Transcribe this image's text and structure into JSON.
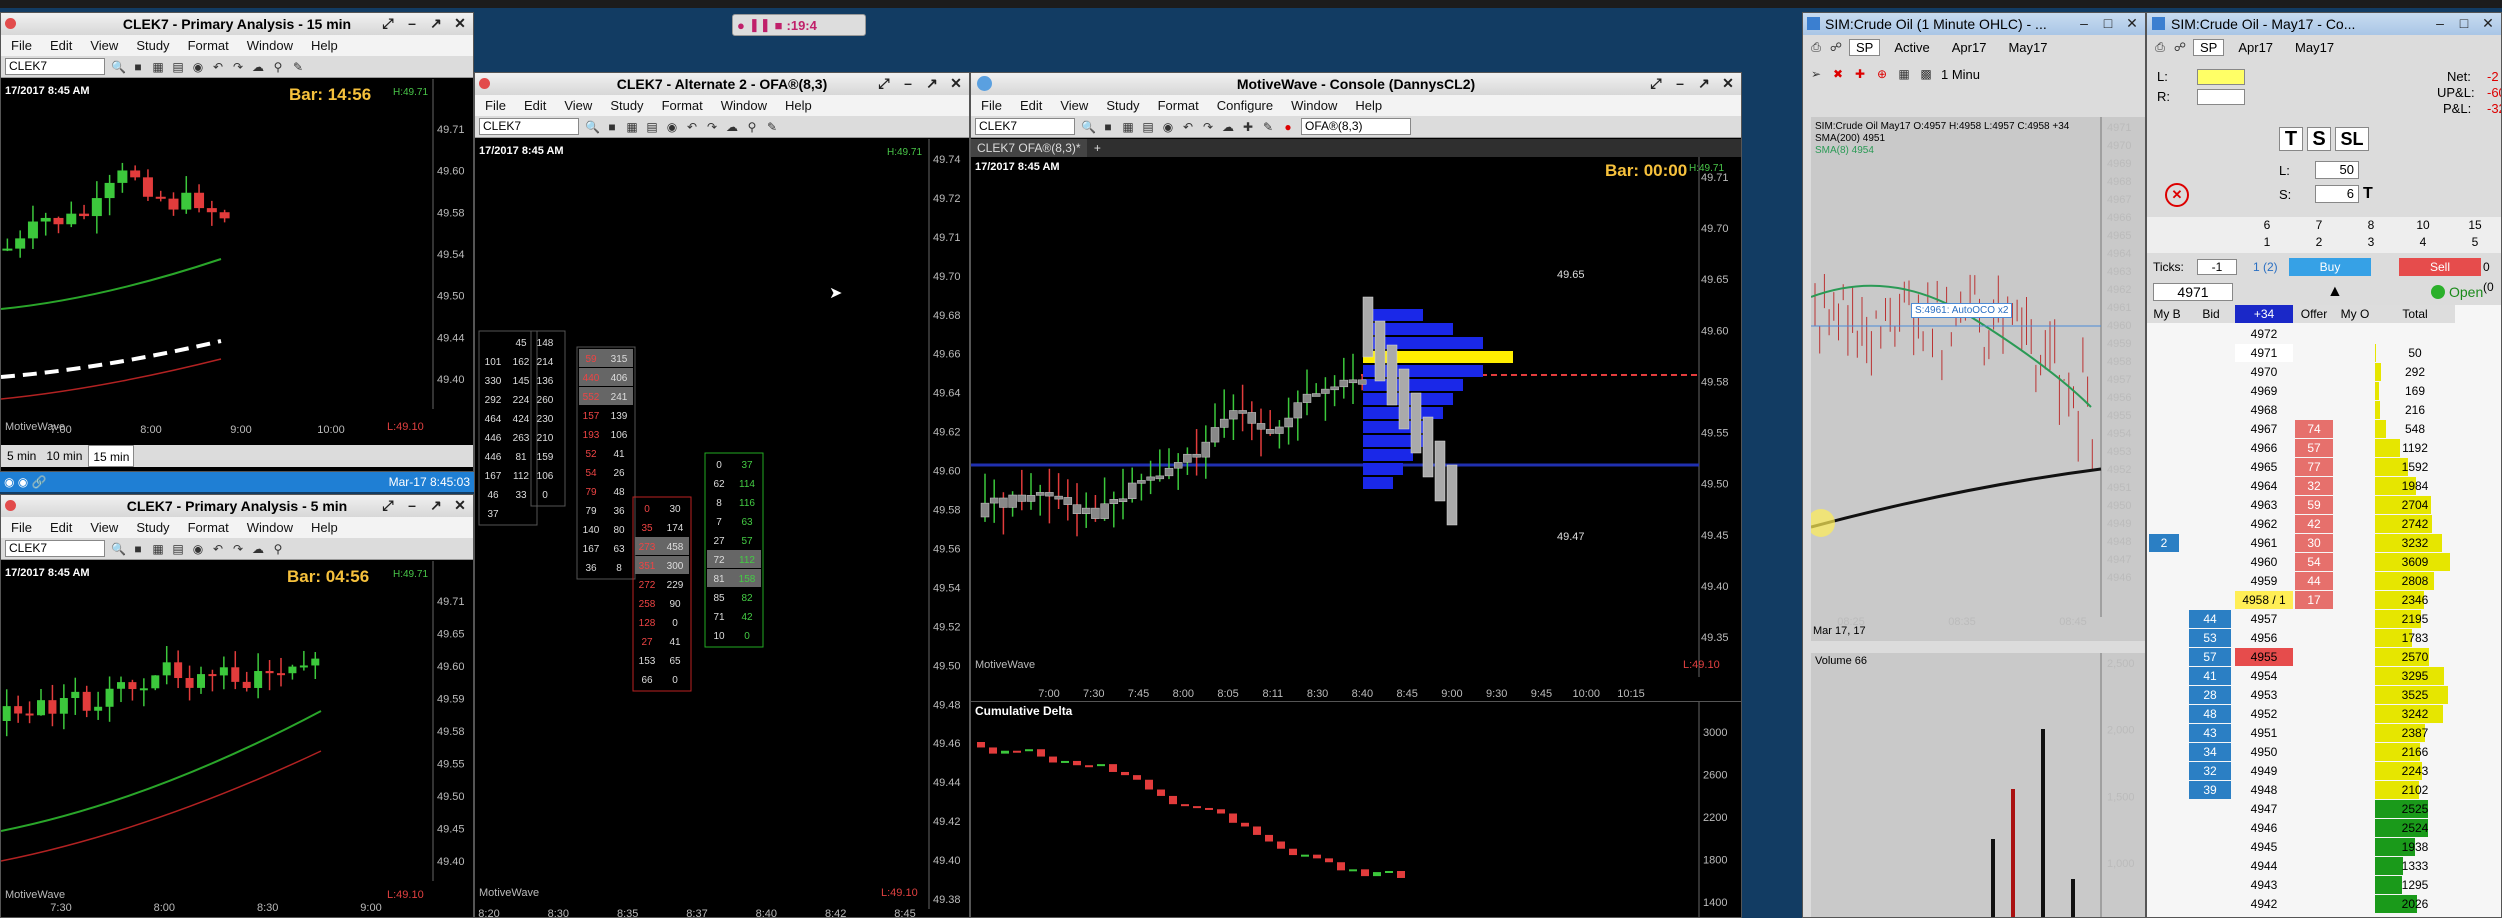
{
  "top_strip": {
    "counter": ":19:4"
  },
  "win15": {
    "title": "CLEK7 - Primary Analysis - 15 min",
    "menu": [
      "File",
      "Edit",
      "View",
      "Study",
      "Format",
      "Window",
      "Help"
    ],
    "symbol": "CLEK7",
    "date": "17/2017 8:45 AM",
    "bar": "Bar: 14:56",
    "high": "H:49.71",
    "low": "L:49.10",
    "watermark": "MotiveWave",
    "prices": [
      "49.71",
      "49.60",
      "49.58",
      "49.54",
      "49.50",
      "49.44",
      "49.40"
    ],
    "times": [
      "7:00",
      "8:00",
      "9:00",
      "10:00"
    ],
    "tabs": [
      "5 min",
      "10 min",
      "15 min"
    ],
    "status_date": "Mar-17 8:45:03"
  },
  "win5": {
    "title": "CLEK7 - Primary Analysis - 5 min",
    "menu": [
      "File",
      "Edit",
      "View",
      "Study",
      "Format",
      "Window",
      "Help"
    ],
    "symbol": "CLEK7",
    "date": "17/2017 8:45 AM",
    "bar": "Bar: 04:56",
    "high": "H:49.71",
    "low": "L:49.10",
    "watermark": "MotiveWave",
    "prices": [
      "49.71",
      "49.65",
      "49.60",
      "49.59",
      "49.58",
      "49.55",
      "49.50",
      "49.45",
      "49.40"
    ],
    "times": [
      "7:30",
      "8:00",
      "8:30",
      "9:00"
    ]
  },
  "win_ofa": {
    "title": "CLEK7 - Alternate 2 - OFA®(8,3)",
    "menu": [
      "File",
      "Edit",
      "View",
      "Study",
      "Format",
      "Window",
      "Help"
    ],
    "symbol": "CLEK7",
    "date": "17/2017 8:45 AM",
    "high": "H:49.71",
    "low": "L:49.10",
    "watermark": "MotiveWave",
    "prices": [
      "49.74",
      "49.72",
      "49.71",
      "49.70",
      "49.68",
      "49.66",
      "49.64",
      "49.62",
      "49.60",
      "49.58",
      "49.56",
      "49.54",
      "49.52",
      "49.50",
      "49.48",
      "49.46",
      "49.44",
      "49.42",
      "49.40",
      "49.38"
    ],
    "times": [
      "8:20",
      "8:30",
      "8:35",
      "8:37",
      "8:40",
      "8:42",
      "8:45"
    ],
    "footprints": [
      {
        "rows": [
          [
            "",
            "45"
          ],
          [
            "101",
            "162"
          ],
          [
            "330",
            "145"
          ],
          [
            "292",
            "224"
          ],
          [
            "464",
            "424"
          ],
          [
            "446",
            "263"
          ],
          [
            "446",
            "81"
          ],
          [
            "167",
            "112"
          ],
          [
            "46",
            "33"
          ],
          [
            "37",
            ""
          ]
        ]
      },
      {
        "rows": [
          [
            "148",
            ""
          ],
          [
            "214",
            ""
          ],
          [
            "136",
            ""
          ],
          [
            "260",
            ""
          ],
          [
            "230",
            ""
          ],
          [
            "210",
            ""
          ],
          [
            "159",
            ""
          ],
          [
            "106",
            ""
          ],
          [
            "0",
            ""
          ]
        ]
      },
      {
        "rows": [
          [
            "59",
            "315"
          ],
          [
            "440",
            "406"
          ],
          [
            "552",
            "241"
          ],
          [
            "157",
            "139"
          ],
          [
            "193",
            "106"
          ],
          [
            "52",
            "41"
          ],
          [
            "54",
            "26"
          ],
          [
            "79",
            "48"
          ],
          [
            "79",
            "36"
          ],
          [
            "140",
            "80"
          ],
          [
            "167",
            "63"
          ],
          [
            "36",
            "8"
          ]
        ]
      },
      {
        "rows": [
          [
            "0",
            "30"
          ],
          [
            "35",
            "174"
          ],
          [
            "273",
            "458"
          ],
          [
            "351",
            "300"
          ],
          [
            "272",
            "229"
          ],
          [
            "258",
            "90"
          ],
          [
            "128",
            "0"
          ],
          [
            "27",
            "41"
          ],
          [
            "153",
            "65"
          ],
          [
            "66",
            "0"
          ]
        ]
      },
      {
        "rows": [
          [
            "0",
            "37"
          ],
          [
            "62",
            "114"
          ],
          [
            "8",
            "116"
          ],
          [
            "7",
            "63"
          ],
          [
            "27",
            "57"
          ],
          [
            "72",
            "112"
          ],
          [
            "81",
            "158"
          ],
          [
            "85",
            "82"
          ],
          [
            "71",
            "42"
          ],
          [
            "10",
            "0"
          ]
        ]
      }
    ]
  },
  "console": {
    "title": "MotiveWave - Console (DannysCL2)",
    "menu": [
      "File",
      "Edit",
      "View",
      "Study",
      "Format",
      "Configure",
      "Window",
      "Help"
    ],
    "symbol": "CLEK7",
    "study": "OFA®(8,3)",
    "tab": "CLEK7 OFA®(8,3)*",
    "date": "17/2017 8:45 AM",
    "bar": "Bar: 00:00",
    "high": "H:49.71",
    "low": "L:49.10",
    "watermark": "MotiveWave",
    "prices": [
      "49.71",
      "49.70",
      "49.65",
      "49.60",
      "49.58",
      "49.55",
      "49.50",
      "49.45",
      "49.40",
      "49.35"
    ],
    "times": [
      "7:00",
      "7:30",
      "7:45",
      "8:00",
      "8:05",
      "8:11",
      "8:30",
      "8:40",
      "8:45",
      "9:00",
      "9:30",
      "9:45",
      "10:00",
      "10:15"
    ],
    "vp_labels": [
      "49.65",
      "49.47"
    ],
    "delta_title": "Cumulative Delta",
    "delta_scale": [
      "3000",
      "2600",
      "2200",
      "1800",
      "1400"
    ]
  },
  "ohlc": {
    "title": "SIM:Crude Oil (1 Minute OHLC) - ...",
    "sel": "SP",
    "tabs": [
      "Active",
      "Apr17",
      "May17"
    ],
    "interval": "1 Minu",
    "legend": [
      "SIM:Crude Oil May17 O:4957 H:4958 L:4957 C:4958 +34",
      "SMA(200) 4951",
      "SMA(8) 4954"
    ],
    "order_label": "S:4961: AutoOCO x2",
    "prices": [
      "4971",
      "4970",
      "4969",
      "4968",
      "4967",
      "4966",
      "4965",
      "4964",
      "4963",
      "4962",
      "4961",
      "4960",
      "4959",
      "4958",
      "4957",
      "4956",
      "4955",
      "4954",
      "4953",
      "4952",
      "4951",
      "4950",
      "4949",
      "4948",
      "4947",
      "4946"
    ],
    "date": "Mar 17, 17",
    "times": [
      "08:25",
      "08:35",
      "08:45"
    ],
    "volume_title": "Volume 66",
    "volume_scale": [
      "2,500",
      "2,000",
      "1,500",
      "1,000"
    ]
  },
  "dom": {
    "title": "SIM:Crude Oil - May17 - Co...",
    "sel": "SP",
    "tabs": [
      "Apr17",
      "May17"
    ],
    "net": "Net:",
    "net_v": "-2",
    "upl": "UP&L:",
    "upl_v": "-60",
    "pl": "P&L:",
    "pl_v": "-32",
    "l_lbl": "L:",
    "r_lbl": "R:",
    "l_qty": "50",
    "s_qty": "6",
    "grid1": [
      "6",
      "7",
      "8",
      "10",
      "15"
    ],
    "grid2": [
      "1",
      "2",
      "3",
      "4",
      "5"
    ],
    "ticks_lbl": "Ticks:",
    "ticks_v": "-1",
    "ticks_pos": "1 (2)",
    "buy": "Buy",
    "sell": "Sell",
    "open_pos": "0 (0",
    "price_field": "4971",
    "open": "Open",
    "headers": [
      "My B",
      "Bid",
      "+34",
      "Offer",
      "My O",
      "Total"
    ],
    "rows": [
      {
        "p": "4972",
        "bid": "",
        "off": "",
        "tot": ""
      },
      {
        "p": "4971",
        "bid": "",
        "off": "",
        "tot": "50"
      },
      {
        "p": "4970",
        "bid": "",
        "off": "",
        "tot": "292"
      },
      {
        "p": "4969",
        "bid": "",
        "off": "",
        "tot": "169"
      },
      {
        "p": "4968",
        "bid": "",
        "off": "",
        "tot": "216"
      },
      {
        "p": "4967",
        "bid": "",
        "off": "74",
        "tot": "548"
      },
      {
        "p": "4966",
        "bid": "",
        "off": "57",
        "tot": "1192"
      },
      {
        "p": "4965",
        "bid": "",
        "off": "77",
        "tot": "1592"
      },
      {
        "p": "4964",
        "bid": "",
        "off": "32",
        "tot": "1984"
      },
      {
        "p": "4963",
        "bid": "",
        "off": "59",
        "tot": "2704"
      },
      {
        "p": "4962",
        "bid": "",
        "off": "42",
        "tot": "2742"
      },
      {
        "p": "4961",
        "bid": "",
        "off": "30",
        "tot": "3232",
        "myb": "2"
      },
      {
        "p": "4960",
        "bid": "",
        "off": "54",
        "tot": "3609"
      },
      {
        "p": "4959",
        "bid": "",
        "off": "44",
        "tot": "2808"
      },
      {
        "p": "4958 / 1",
        "bid": "",
        "off": "17",
        "tot": "2346"
      },
      {
        "p": "4957",
        "bid": "44",
        "off": "",
        "tot": "2195"
      },
      {
        "p": "4956",
        "bid": "53",
        "off": "",
        "tot": "1783"
      },
      {
        "p": "4955",
        "bid": "57",
        "off": "",
        "tot": "2570"
      },
      {
        "p": "4954",
        "bid": "41",
        "off": "",
        "tot": "3295"
      },
      {
        "p": "4953",
        "bid": "28",
        "off": "",
        "tot": "3525"
      },
      {
        "p": "4952",
        "bid": "48",
        "off": "",
        "tot": "3242"
      },
      {
        "p": "4951",
        "bid": "43",
        "off": "",
        "tot": "2387"
      },
      {
        "p": "4950",
        "bid": "34",
        "off": "",
        "tot": "2166"
      },
      {
        "p": "4949",
        "bid": "32",
        "off": "",
        "tot": "2243"
      },
      {
        "p": "4948",
        "bid": "39",
        "off": "",
        "tot": "2102"
      },
      {
        "p": "4947",
        "bid": "",
        "off": "",
        "tot": "2525"
      },
      {
        "p": "4946",
        "bid": "",
        "off": "",
        "tot": "2524"
      },
      {
        "p": "4945",
        "bid": "",
        "off": "",
        "tot": "1938"
      },
      {
        "p": "4944",
        "bid": "",
        "off": "",
        "tot": "1333"
      },
      {
        "p": "4943",
        "bid": "",
        "off": "",
        "tot": "1295"
      },
      {
        "p": "4942",
        "bid": "",
        "off": "",
        "tot": "2026"
      }
    ]
  }
}
